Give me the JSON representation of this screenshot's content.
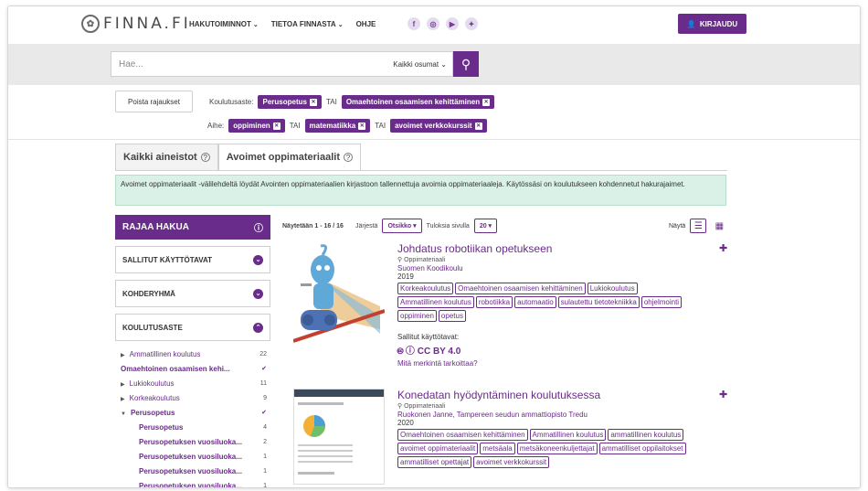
{
  "header": {
    "logo_text": "FINNA.FI",
    "nav": [
      {
        "label": "HAKUTOIMINNOT",
        "dropdown": true
      },
      {
        "label": "TIETOA FINNASTA",
        "dropdown": true
      },
      {
        "label": "OHJE",
        "dropdown": false
      }
    ],
    "social": [
      "facebook-icon",
      "instagram-icon",
      "youtube-icon",
      "twitter-icon"
    ],
    "login_label": "KIRJAUDU",
    "accent": "#6a2c8a"
  },
  "search": {
    "placeholder": "Hae...",
    "scope": "Kaikki osumat"
  },
  "filters": {
    "clear_label": "Poista rajaukset",
    "education_label": "Koulutusaste:",
    "education_chips": [
      "Perusopetus",
      "Omaehtoinen osaamisen kehittäminen"
    ],
    "subject_label": "Aihe:",
    "subject_chips": [
      "oppiminen",
      "matematiikka",
      "avoimet verkkokurssit"
    ],
    "or_label": "TAI"
  },
  "tabs": [
    {
      "label": "Kaikki aineistot",
      "active": false
    },
    {
      "label": "Avoimet oppimateriaalit",
      "active": true
    }
  ],
  "info": "Avoimet oppimateriaalit -välilehdeltä löydät Avointen oppimateriaalien kirjastoon tallennettuja avoimia oppimateriaaleja. Käytössäsi on koulutukseen kohdennetut hakurajaimet.",
  "facets": {
    "header": "RAJAA HAKUA",
    "boxes": [
      "SALLITUT KÄYTTÖTAVAT",
      "KOHDERYHMÄ",
      "KOULUTUSASTE"
    ],
    "items": [
      {
        "label": "Ammatillinen koulutus",
        "count": "22",
        "level": 0,
        "tri": "▶",
        "selected": false
      },
      {
        "label": "Omaehtoinen osaamisen kehi...",
        "count": "✔",
        "level": 0,
        "tri": "",
        "selected": true
      },
      {
        "label": "Lukiokoulutus",
        "count": "11",
        "level": 0,
        "tri": "▶",
        "selected": false
      },
      {
        "label": "Korkeakoulutus",
        "count": "9",
        "level": 0,
        "tri": "▶",
        "selected": false
      },
      {
        "label": "Perusopetus",
        "count": "✔",
        "level": 0,
        "tri": "▼",
        "selected": true
      },
      {
        "label": "Perusopetus",
        "count": "4",
        "level": 1,
        "tri": "",
        "selected": true
      },
      {
        "label": "Perusopetuksen vuosiluoka...",
        "count": "2",
        "level": 1,
        "tri": "",
        "selected": true
      },
      {
        "label": "Perusopetuksen vuosiluoka...",
        "count": "1",
        "level": 1,
        "tri": "",
        "selected": true
      },
      {
        "label": "Perusopetuksen vuosiluoka...",
        "count": "1",
        "level": 1,
        "tri": "",
        "selected": true
      },
      {
        "label": "Perusopetuksen vuosiluoka...",
        "count": "1",
        "level": 1,
        "tri": "",
        "selected": true
      }
    ]
  },
  "results_toolbar": {
    "showing": "Näytetään 1 - 16 / 16",
    "sort_label": "Järjestä",
    "sort_value": "Otsikko",
    "per_page_label": "Tuloksia sivulla",
    "per_page_value": "20",
    "view_label": "Näytä"
  },
  "results": [
    {
      "title": "Johdatus robotiikan opetukseen",
      "format": "Oppimateriaali",
      "author": "Suomen Koodikoulu",
      "year": "2019",
      "tags": [
        "Korkeakoulutus",
        "Omaehtoinen osaamisen kehittäminen",
        "Lukiokoulutus",
        "Ammatillinen koulutus",
        "robotiikka",
        "automaatio",
        "sulautettu tietotekniikka",
        "ohjelmointi",
        "oppiminen",
        "opetus"
      ],
      "rights_label": "Sallitut käyttötavat:",
      "license": "CC BY 4.0",
      "license_more": "Mitä merkintä tarkoittaa?"
    },
    {
      "title": "Konedatan hyödyntäminen koulutuksessa",
      "format": "Oppimateriaali",
      "author": "Ruokonen Janne, Tampereen seudun ammattiopisto Tredu",
      "year": "2020",
      "tags": [
        "Omaehtoinen osaamisen kehittäminen",
        "Ammatillinen koulutus",
        "ammatillinen koulutus",
        "avoimet oppimateriaalit",
        "metsäala",
        "metsäkoneenkuljettajat",
        "ammatilliset oppilaitokset",
        "ammatilliset opettajat",
        "avoimet verkkokurssit"
      ]
    }
  ]
}
